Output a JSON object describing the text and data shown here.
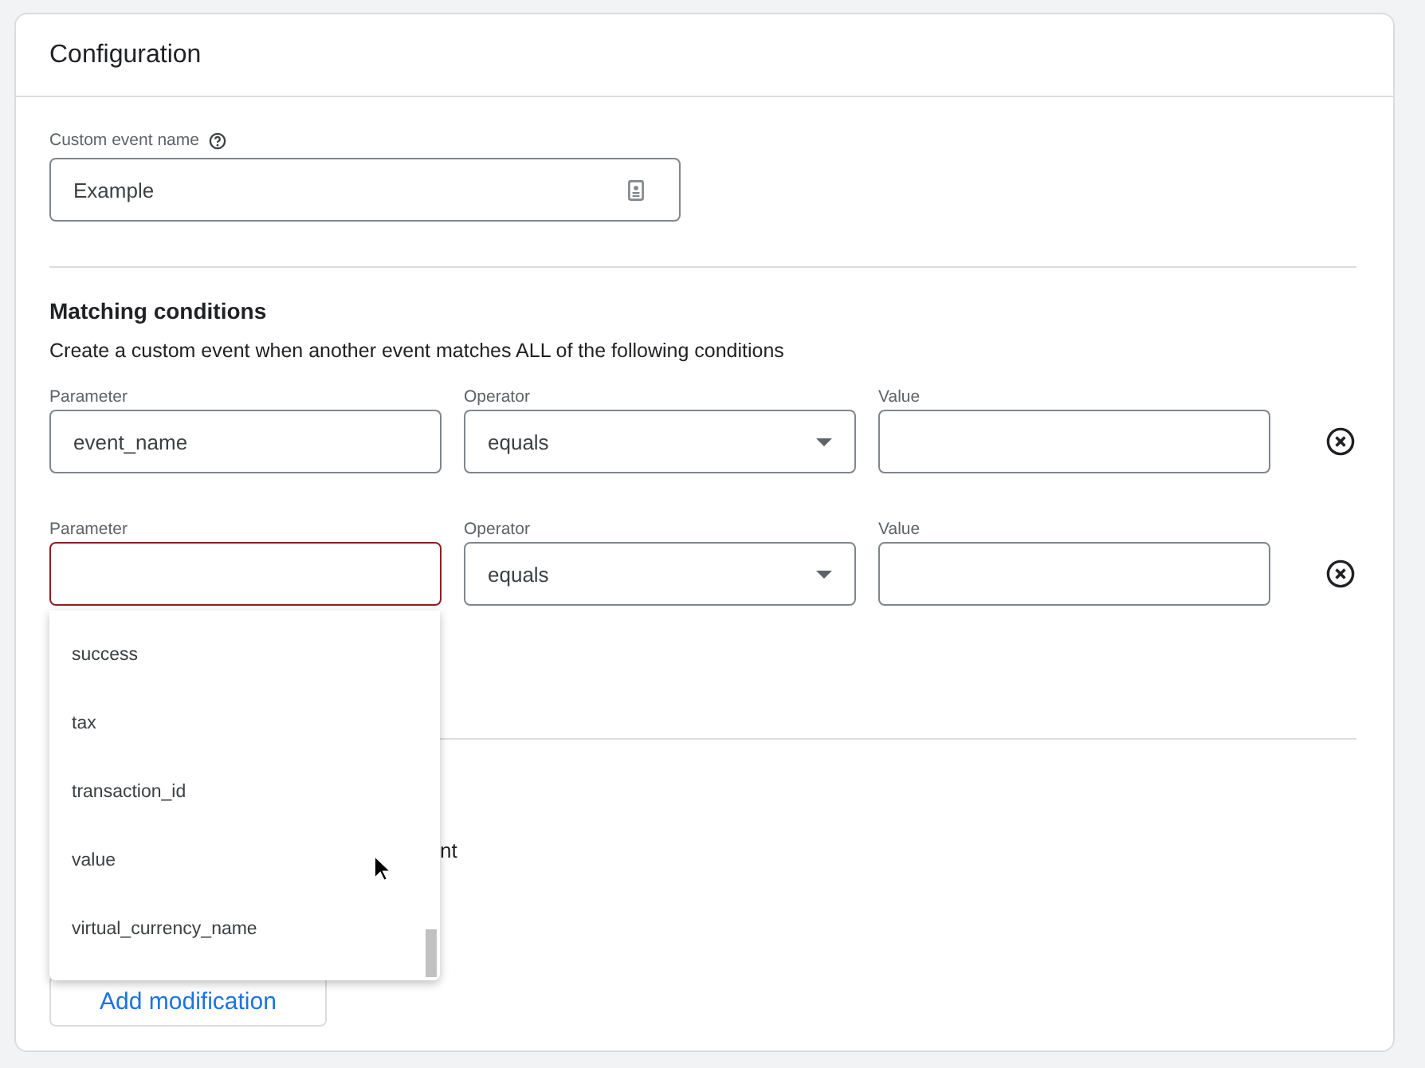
{
  "header": {
    "title": "Configuration"
  },
  "event_name": {
    "label": "Custom event name",
    "value": "Example"
  },
  "matching": {
    "title": "Matching conditions",
    "description": "Create a custom event when another event matches ALL of the following conditions",
    "conditions": [
      {
        "parameter_label": "Parameter",
        "parameter": "event_name",
        "operator_label": "Operator",
        "operator": "equals",
        "value_label": "Value",
        "focused": false
      },
      {
        "parameter_label": "Parameter",
        "operator_label": "Operator",
        "operator": "equals",
        "value_label": "Value",
        "focused": true
      }
    ]
  },
  "dropdown": {
    "options": [
      {
        "label": "success"
      },
      {
        "label": "tax"
      },
      {
        "label": "transaction_id"
      },
      {
        "label": "value"
      },
      {
        "label": "virtual_currency_name"
      }
    ]
  },
  "modify": {
    "partial_text": "nt",
    "add_button": "Add modification"
  }
}
